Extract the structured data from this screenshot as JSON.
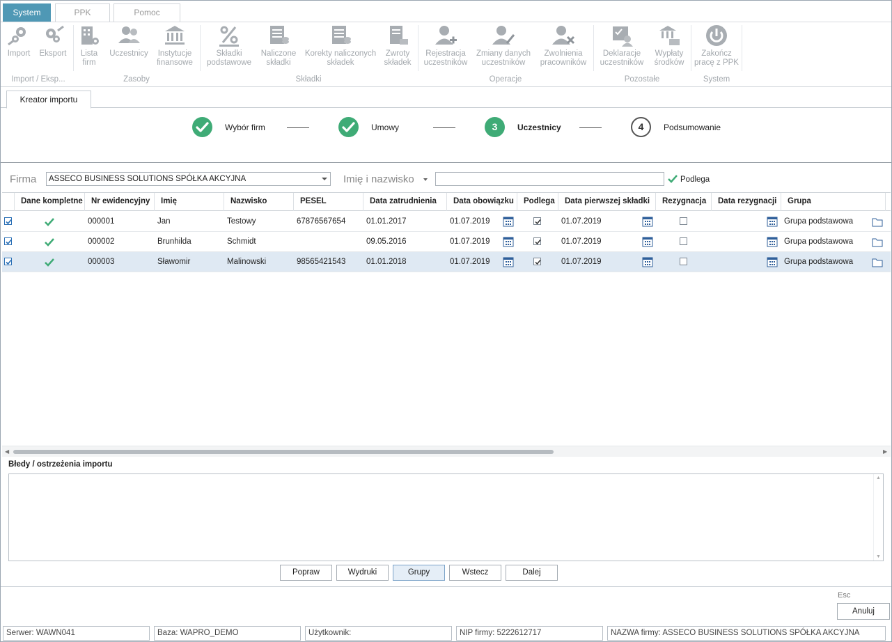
{
  "top_tabs": [
    "System",
    "PPK",
    "Pomoc"
  ],
  "ribbon": {
    "buttons": [
      {
        "label1": "Import",
        "label2": "",
        "icon": "import-icon"
      },
      {
        "label1": "Eksport",
        "label2": "",
        "icon": "export-icon"
      },
      {
        "label1": "Lista",
        "label2": "firm",
        "icon": "company-list-icon"
      },
      {
        "label1": "Uczestnicy",
        "label2": "",
        "icon": "participants-icon"
      },
      {
        "label1": "Instytucje",
        "label2": "finansowe",
        "icon": "bank-icon"
      },
      {
        "label1": "Składki",
        "label2": "podstawowe",
        "icon": "percent-icon"
      },
      {
        "label1": "Naliczone",
        "label2": "składki",
        "icon": "calculated-contributions-icon"
      },
      {
        "label1": "Korekty naliczonych",
        "label2": "składek",
        "icon": "corrections-icon"
      },
      {
        "label1": "Zwroty",
        "label2": "składek",
        "icon": "returns-icon"
      },
      {
        "label1": "Rejestracja",
        "label2": "uczestników",
        "icon": "user-add-icon"
      },
      {
        "label1": "Zmiany danych",
        "label2": "uczestników",
        "icon": "user-edit-icon"
      },
      {
        "label1": "Zwolnienia",
        "label2": "pracowników",
        "icon": "user-remove-icon"
      },
      {
        "label1": "Deklaracje",
        "label2": "uczestników",
        "icon": "declarations-icon"
      },
      {
        "label1": "Wypłaty",
        "label2": "środków",
        "icon": "payouts-icon"
      },
      {
        "label1": "Zakończ",
        "label2": "pracę z PPK",
        "icon": "power-icon"
      }
    ],
    "groups": [
      "Import / Eksp...",
      "Zasoby",
      "Składki",
      "Operacje",
      "Pozostałe",
      "System"
    ]
  },
  "doc_tab": "Kreator importu",
  "wizard": {
    "steps": [
      {
        "label": "Wybór firm",
        "state": "done",
        "num": "1"
      },
      {
        "label": "Umowy",
        "state": "done",
        "num": "2"
      },
      {
        "label": "Uczestnicy",
        "state": "current",
        "num": "3"
      },
      {
        "label": "Podsumowanie",
        "state": "todo",
        "num": "4"
      }
    ]
  },
  "filter": {
    "firma_label": "Firma",
    "firma_value": "ASSECO BUSINESS SOLUTIONS SPÓŁKA AKCYJNA",
    "name_label": "Imię i nazwisko",
    "name_value": "",
    "podlega_label": "Podlega"
  },
  "grid": {
    "columns": [
      "Dane kompletne",
      "Nr ewidencyjny",
      "Imię",
      "Nazwisko",
      "PESEL",
      "Data zatrudnienia",
      "Data obowiązku",
      "Podlega",
      "Data pierwszej składki",
      "Rezygnacja",
      "Data rezygnacji",
      "Grupa"
    ],
    "rows": [
      {
        "selected": true,
        "complete": true,
        "nr": "000001",
        "imie": "Jan",
        "nazwisko": "Testowy",
        "pesel": "67876567654",
        "zatrudnienie": "01.01.2017",
        "obowiazek": "01.07.2019",
        "podlega": true,
        "pierwsza": "01.07.2019",
        "rezygnacja": false,
        "data_rez": "",
        "grupa": "Grupa podstawowa"
      },
      {
        "selected": true,
        "complete": true,
        "nr": "000002",
        "imie": "Brunhilda",
        "nazwisko": "Schmidt",
        "pesel": "",
        "zatrudnienie": "09.05.2016",
        "obowiazek": "01.07.2019",
        "podlega": true,
        "pierwsza": "01.07.2019",
        "rezygnacja": false,
        "data_rez": "",
        "grupa": "Grupa podstawowa"
      },
      {
        "selected": true,
        "complete": true,
        "nr": "000003",
        "imie": "Sławomir",
        "nazwisko": "Malinowski",
        "pesel": "98565421543",
        "zatrudnienie": "01.01.2018",
        "obowiazek": "01.07.2019",
        "podlega": true,
        "pierwsza": "01.07.2019",
        "rezygnacja": false,
        "data_rez": "",
        "grupa": "Grupa podstawowa"
      }
    ]
  },
  "errors_title": "Błedy / ostrzeżenia importu",
  "buttons": {
    "popraw": "Popraw",
    "wydruki": "Wydruki",
    "grupy": "Grupy",
    "wstecz": "Wstecz",
    "dalej": "Dalej",
    "esc": "Esc",
    "anuluj": "Anuluj"
  },
  "status_bar": {
    "serwer": "Serwer: WAWN041",
    "baza": "Baza: WAPRO_DEMO",
    "uzytkownik": "Użytkownik:",
    "nip": "NIP firmy: 5222612717",
    "nazwa": "NAZWA firmy: ASSECO BUSINESS SOLUTIONS SPÓŁKA AKCYJNA"
  },
  "colors": {
    "accent": "#4f98b5",
    "success": "#3fab76",
    "selected_row": "#dfe9f3"
  }
}
